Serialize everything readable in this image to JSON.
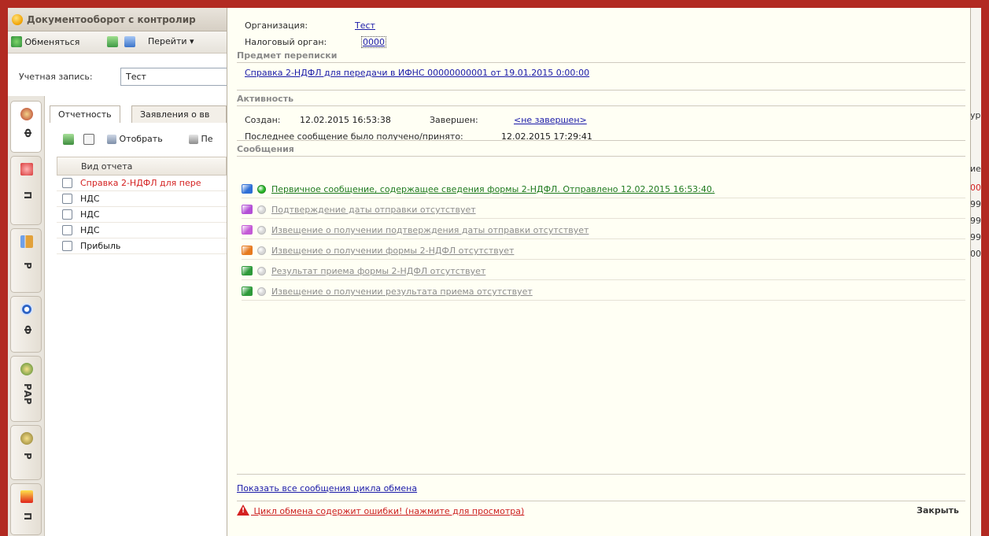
{
  "bg_window": {
    "title": "Документооборот с контролир",
    "toolbar": {
      "exchange_label": "Обменяться",
      "go_label": "Перейти ▾"
    },
    "account_label": "Учетная запись:",
    "account_value": "Тест",
    "tabs": [
      "Отчетность",
      "Заявления о вв"
    ],
    "inner_toolbar": {
      "filter_label": "Отобрать",
      "print_label": "Пе"
    },
    "table": {
      "header": "Вид отчета",
      "rows": [
        {
          "label": "Справка 2-НДФЛ для пере",
          "highlight": true
        },
        {
          "label": "НДС",
          "highlight": false
        },
        {
          "label": "НДС",
          "highlight": false
        },
        {
          "label": "НДС",
          "highlight": false
        },
        {
          "label": "Прибыль",
          "highlight": false
        }
      ]
    },
    "side_tabs": [
      {
        "label": "Ф",
        "icon": "emblem-icon"
      },
      {
        "label": "П",
        "icon": "building-icon"
      },
      {
        "label": "Р",
        "icon": "chart-icon"
      },
      {
        "label": "Ф",
        "icon": "target-icon"
      },
      {
        "label": "РАР",
        "icon": "emblem-green-icon"
      },
      {
        "label": "Р",
        "icon": "emblem-icon"
      },
      {
        "label": "П",
        "icon": "logo-1c-icon"
      }
    ],
    "right_strip": [
      "ур",
      "ие",
      "00",
      "99",
      "99",
      "99",
      "00"
    ]
  },
  "popup": {
    "org_label": "Организация:",
    "org_value": "Тест",
    "tax_label": "Налоговый орган:",
    "tax_value": "0000",
    "subject_header": "Предмет переписки",
    "subject_link": "Справка 2-НДФЛ для передачи в ИФНС 00000000001 от 19.01.2015 0:00:00",
    "activity_header": "Активность",
    "created_label": "Создан:",
    "created_value": "12.02.2015 16:53:38",
    "finished_label": "Завершен:",
    "finished_value": "<не завершен>",
    "last_msg_label": "Последнее сообщение было получено/принято:",
    "last_msg_value": "12.02.2015 17:29:41",
    "messages_header": "Сообщения",
    "messages": [
      {
        "text": "Первичное сообщение, содержащее сведения формы 2-НДФЛ. Отправлено 12.02.2015 16:53:40.",
        "status": "active",
        "icon": "envelope-send-icon",
        "icon_color": "#2e6fd6",
        "dot_color": "#29b629"
      },
      {
        "text": "Подтверждение даты отправки отсутствует",
        "status": "inactive",
        "icon": "envelope-confirm-icon",
        "icon_color": "#b34fd6",
        "dot_color": "#d6d6d6"
      },
      {
        "text": "Извещение о получении подтверждения даты отправки отсутствует",
        "status": "inactive",
        "icon": "envelope-notice-icon",
        "icon_color": "#c45ad6",
        "dot_color": "#d6d6d6"
      },
      {
        "text": "Извещение о получении формы 2-НДФЛ отсутствует",
        "status": "inactive",
        "icon": "envelope-receipt-icon",
        "icon_color": "#e67a1e",
        "dot_color": "#d6d6d6"
      },
      {
        "text": "Результат приема формы 2-НДФЛ отсутствует",
        "status": "inactive",
        "icon": "envelope-result-icon",
        "icon_color": "#2e9a3a",
        "dot_color": "#d6d6d6"
      },
      {
        "text": "Извещение о получении результата приема отсутствует",
        "status": "inactive",
        "icon": "envelope-result-notice-icon",
        "icon_color": "#2e9a3a",
        "dot_color": "#d6d6d6"
      }
    ],
    "show_all_link": "Показать все сообщения цикла обмена",
    "error_link": "Цикл обмена содержит ошибки! (нажмите для просмотра)",
    "close_label": "Закрыть"
  }
}
